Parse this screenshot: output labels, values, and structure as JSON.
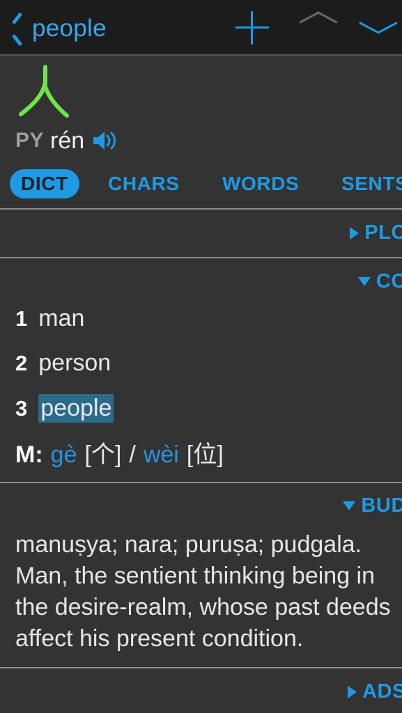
{
  "topbar": {
    "back_label": "people",
    "back_icon": "chevron-left-icon",
    "add_icon": "plus-icon",
    "prev_icon": "chevron-up-icon",
    "next_icon": "chevron-down-icon",
    "accent_color": "#1e9ae5",
    "disabled_color": "#6b6b6b"
  },
  "entry": {
    "character": "人",
    "character_color": "#6ee64a",
    "pinyin_tag": "PY",
    "pinyin": "rén",
    "audio_icon": "speaker-icon"
  },
  "tabs": [
    {
      "label": "DICT",
      "active": true
    },
    {
      "label": "CHARS",
      "active": false
    },
    {
      "label": "WORDS",
      "active": false
    },
    {
      "label": "SENTS",
      "active": false
    }
  ],
  "sections": [
    {
      "key": "plc",
      "label": "PLC",
      "expanded": false,
      "marker": "▶"
    },
    {
      "key": "cc",
      "label": "CC",
      "expanded": true,
      "marker": "▼"
    },
    {
      "key": "bud",
      "label": "BUD",
      "expanded": true,
      "marker": "▼"
    },
    {
      "key": "ads",
      "label": "ADS",
      "expanded": false,
      "marker": "▶"
    }
  ],
  "cc": {
    "definitions": [
      {
        "num": "1",
        "text": "man",
        "highlighted": false
      },
      {
        "num": "2",
        "text": "person",
        "highlighted": false
      },
      {
        "num": "3",
        "text": "people",
        "highlighted": true
      }
    ],
    "measure": {
      "label": "M:",
      "first_pinyin": "gè",
      "first_char": "[个]",
      "separator": "/",
      "second_pinyin": "wèi",
      "second_char": "[位]"
    },
    "highlight_color": "#2c6a8c"
  },
  "bud": {
    "body": "manuṣya; nara; puruṣa; pudgala. Man, the sentient thinking being in the desire-realm, whose past deeds affect his present condition."
  }
}
